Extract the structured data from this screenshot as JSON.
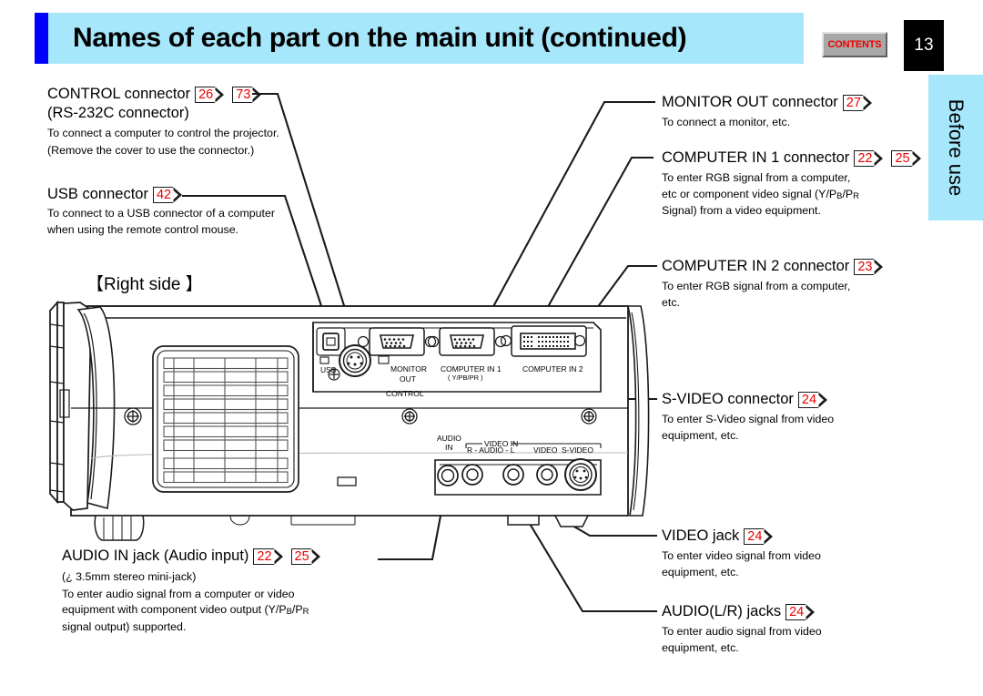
{
  "header": {
    "title": "Names of each part on the main unit (continued)",
    "contents_label": "CONTENTS",
    "page_number": "13",
    "band_color": "#a6e7fb",
    "accent_bar_color": "#0000ff",
    "contents_text_color": "#ee0000"
  },
  "side_tab": {
    "label": "Before use",
    "color": "#a6e7fb"
  },
  "section_label": "【Right side 】",
  "callouts": {
    "control": {
      "title": "CONTROL connector",
      "refs": [
        "26",
        "73"
      ],
      "subtitle": "(RS-232C connector)",
      "body": "To connect a computer to control the projector. (Remove the cover to use the connector.)"
    },
    "usb": {
      "title": "USB connector",
      "refs": [
        "42"
      ],
      "body": "To connect to a USB connector of a computer when using the remote control mouse."
    },
    "monitor_out": {
      "title": "MONITOR OUT connector",
      "refs": [
        "27"
      ],
      "body": "To connect a monitor, etc."
    },
    "computer_in_1": {
      "title": "COMPUTER IN 1 connector",
      "refs": [
        "22",
        "25"
      ],
      "body_line1": "To enter RGB signal from a computer,",
      "body_line2_pre": "etc or component video signal (Y/P",
      "body_line2_sub1": "B",
      "body_line2_mid": "/P",
      "body_line2_sub2": "R",
      "body_line3": "Signal) from a video equipment."
    },
    "computer_in_2": {
      "title": "COMPUTER IN 2 connector",
      "refs": [
        "23"
      ],
      "body": "To enter RGB signal from a computer, etc."
    },
    "s_video": {
      "title": "S-VIDEO connector",
      "refs": [
        "24"
      ],
      "body": "To enter S-Video signal from video equipment, etc."
    },
    "video": {
      "title": "VIDEO jack",
      "refs": [
        "24"
      ],
      "body": "To enter video signal from video equipment, etc."
    },
    "audio_lr": {
      "title": "AUDIO(L/R) jacks",
      "refs": [
        "24"
      ],
      "body": "To enter audio signal from video equipment, etc."
    },
    "audio_in": {
      "title": "AUDIO IN jack (Audio input)",
      "refs": [
        "22",
        "25"
      ],
      "subtitle": "(¿ 3.5mm stereo mini-jack)",
      "body_line1": "To enter audio signal from a computer or video",
      "body_line2_pre": "equipment with component video output (Y/P",
      "body_line2_sub1": "B",
      "body_line2_mid": "/P",
      "body_line2_sub2": "R",
      "body_line3": "signal output) supported."
    }
  },
  "diagram_labels": {
    "usb": "USB",
    "control": "CONTROL",
    "monitor_out_line1": "MONITOR",
    "monitor_out_line2": "OUT",
    "computer_in_1_line1": "COMPUTER IN 1",
    "computer_in_1_line2": "( Y/PB/PR )",
    "computer_in_2": "COMPUTER IN 2",
    "audio_in_line1": "AUDIO",
    "audio_in_line2": "IN",
    "video_in": "VIDEO IN",
    "r_audio_l": "R - AUDIO - L",
    "video": "VIDEO",
    "s_video": "S-VIDEO"
  }
}
